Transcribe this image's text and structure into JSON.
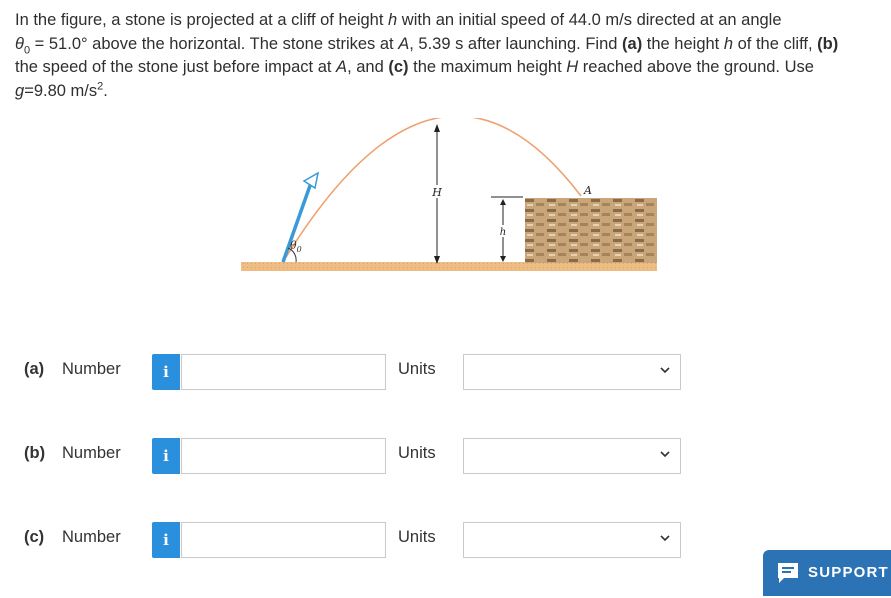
{
  "question": {
    "line1": "In the figure, a stone is projected at a cliff of height ",
    "h1": "h",
    "line1b": " with an initial speed of 44.0 m/s directed at an angle",
    "theta": "θ",
    "theta_sub": "0",
    "line2a": " = 51.0° above the horizontal. The stone strikes at ",
    "A1": "A",
    "line2b": ", 5.39 s after launching. Find ",
    "pa": "(a)",
    "line2c": " the height ",
    "h2": "h",
    "line2d": " of the cliff, ",
    "pb": "(b)",
    "line3a": "the speed of the stone just before impact at ",
    "A2": "A",
    "line3b": ", and ",
    "pc": "(c)",
    "line3c": " the maximum height ",
    "H1": "H",
    "line3d": " reached above the ground. Use",
    "g": "g",
    "line4": "=9.80 m/s",
    "sq": "2",
    "end": "."
  },
  "figure": {
    "label_H": "H",
    "label_h": "h",
    "label_A": "A",
    "label_theta": "θ",
    "label_theta_sub": "0"
  },
  "rows": [
    {
      "part": "(a)",
      "number_label": "Number",
      "info": "i",
      "value": "",
      "units_label": "Units",
      "units_value": ""
    },
    {
      "part": "(b)",
      "number_label": "Number",
      "info": "i",
      "value": "",
      "units_label": "Units",
      "units_value": ""
    },
    {
      "part": "(c)",
      "number_label": "Number",
      "info": "i",
      "value": "",
      "units_label": "Units",
      "units_value": ""
    }
  ],
  "support": {
    "label": "SUPPORT"
  },
  "colors": {
    "info_blue": "#2a8fdc",
    "support_blue": "#2c73b6",
    "trajectory": "#f0a070",
    "arrow": "#3a9ad9",
    "ground": "#e8b878"
  }
}
